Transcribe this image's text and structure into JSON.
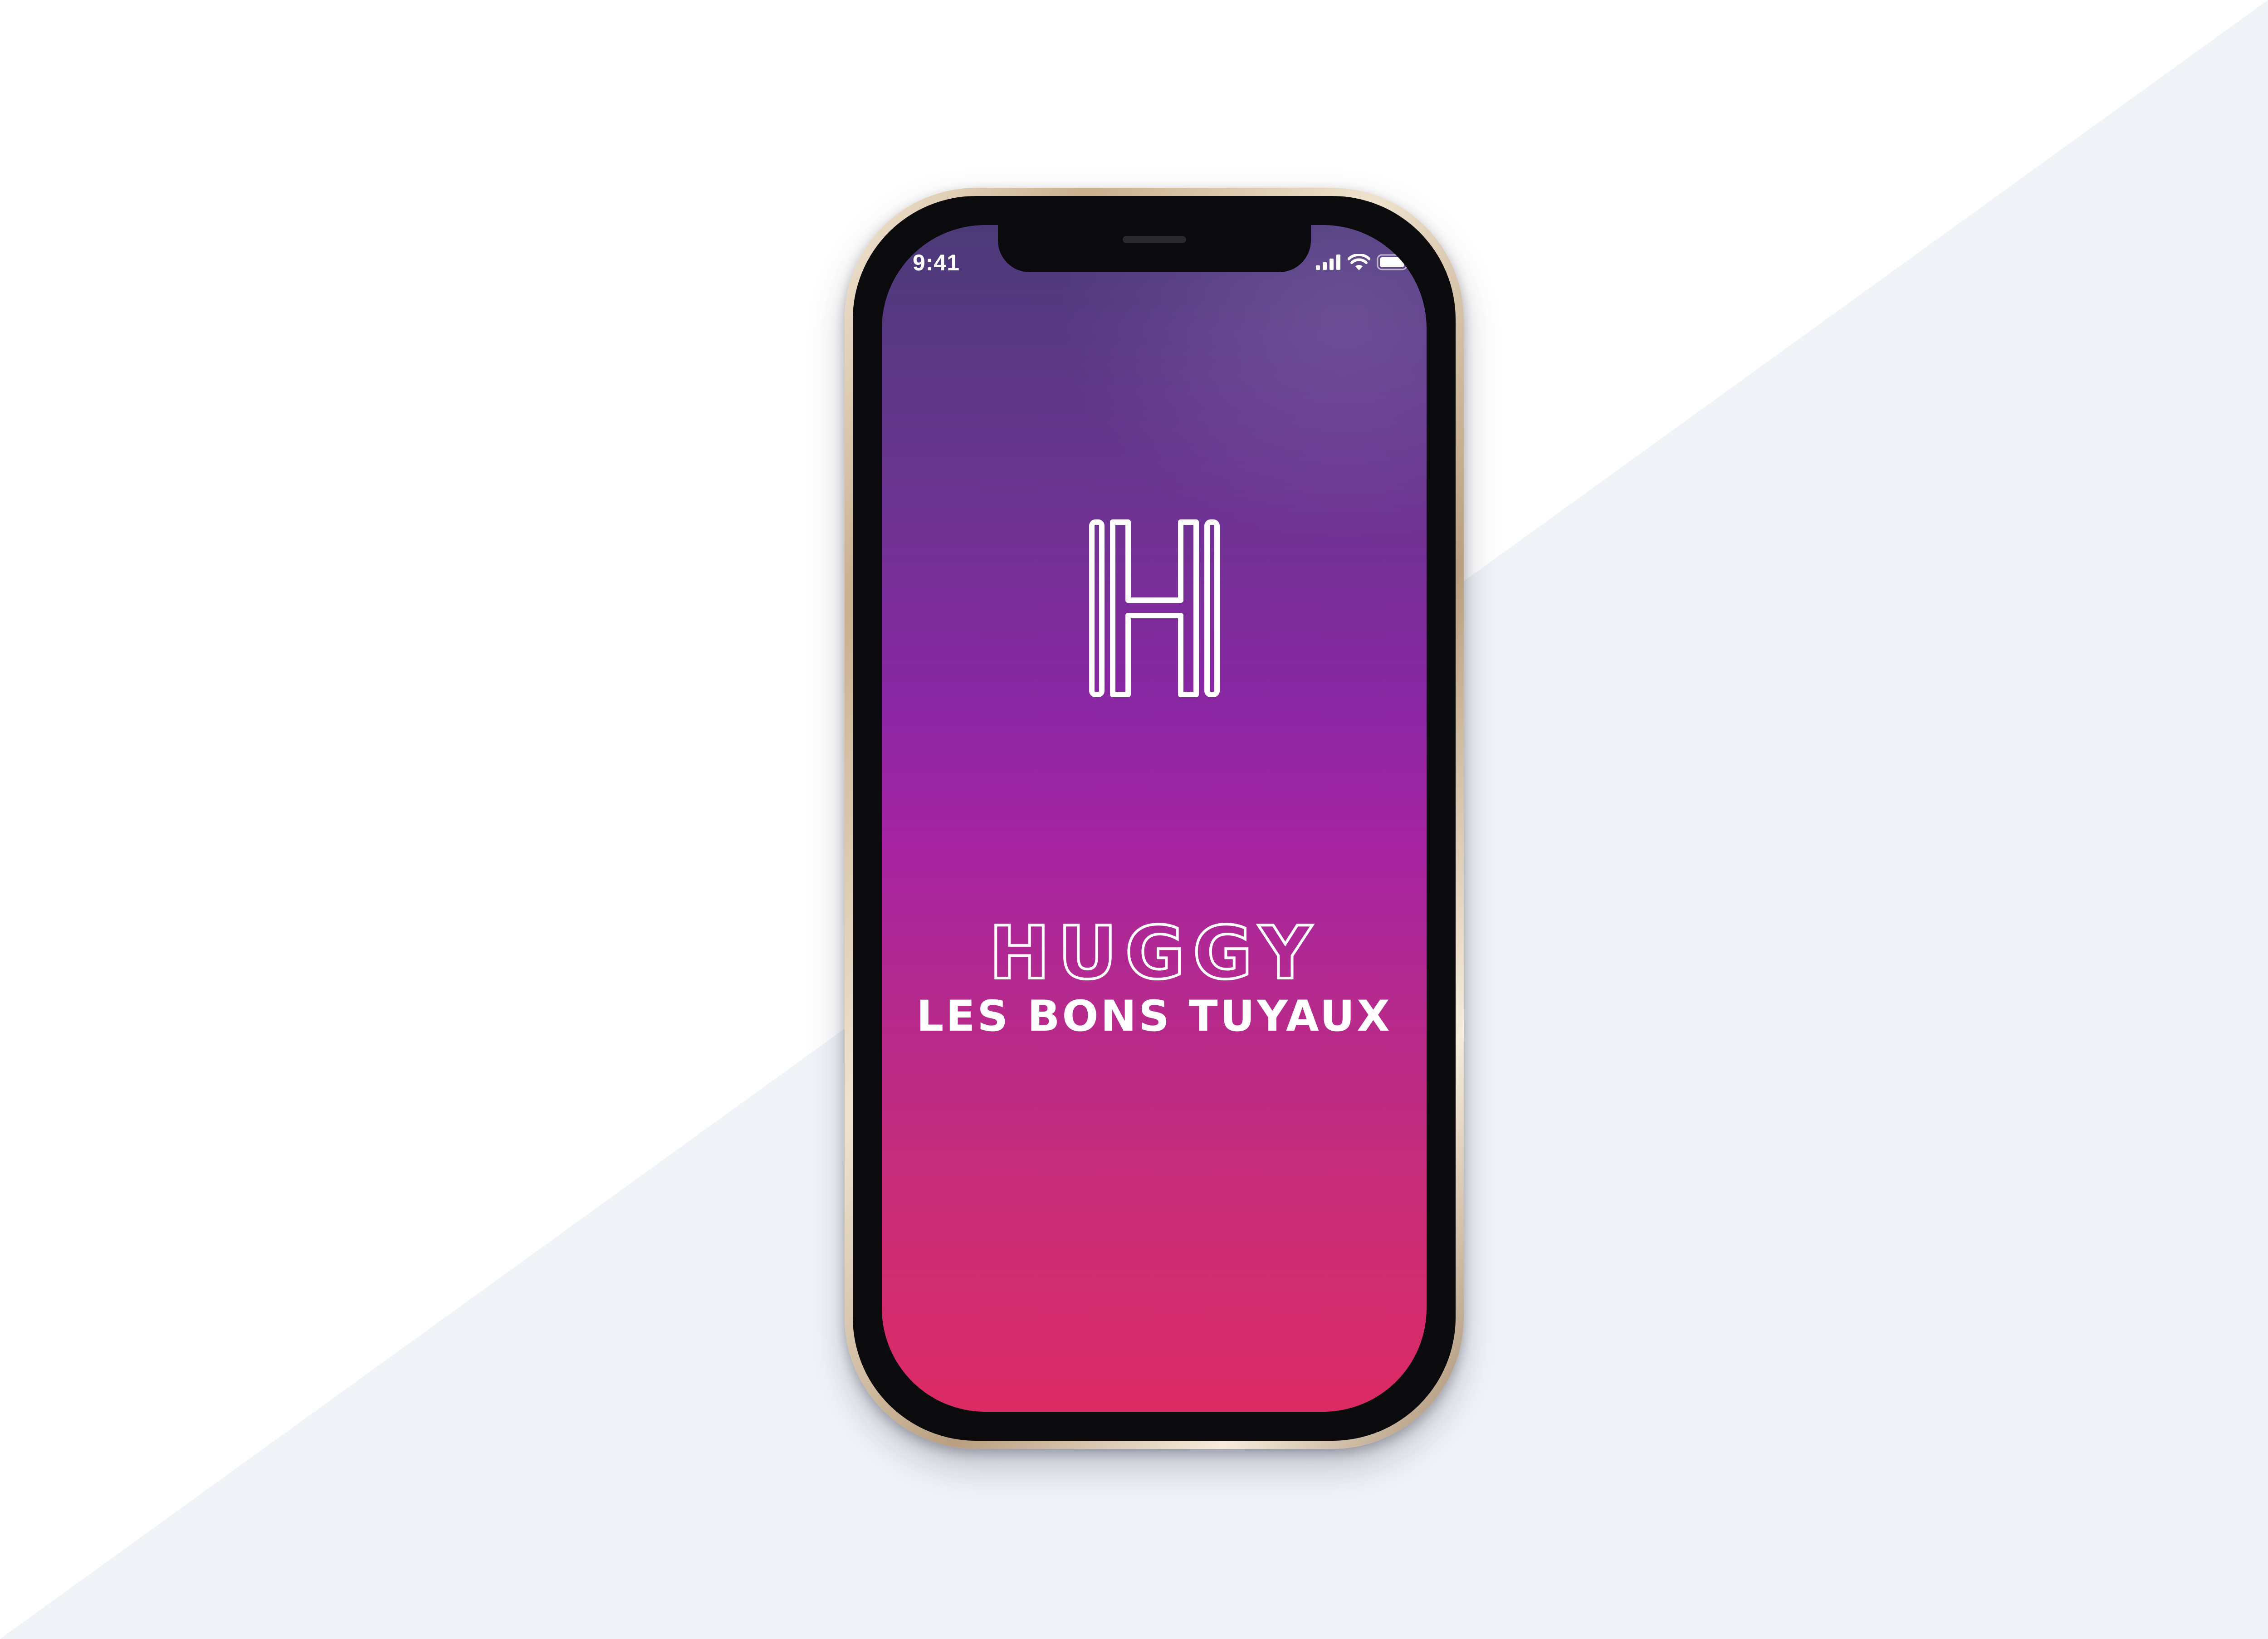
{
  "background": {
    "light_color": "#ffffff",
    "shade_color": "#f0f3f8"
  },
  "phone": {
    "frame_color": "#c9b08e",
    "status_bar": {
      "time": "9:41",
      "icons": [
        "cellular-signal-icon",
        "wifi-icon",
        "battery-icon"
      ]
    },
    "screen": {
      "gradient_top": "#4b3a78",
      "gradient_middle": "#a523a2",
      "gradient_bottom": "#dc2b64",
      "logo_icon": "h-letter-logo-icon",
      "brand_name": "HUGGY",
      "tagline": "LES BONS TUYAUX"
    }
  }
}
